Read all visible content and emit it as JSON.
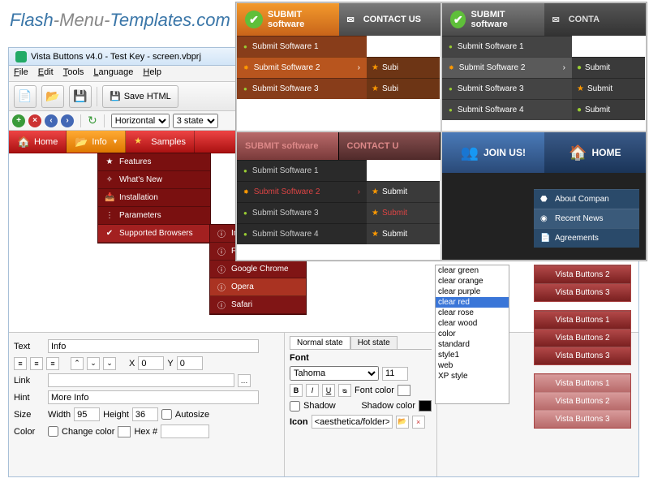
{
  "site_title_prefix": "Flash",
  "site_title_mid": "-Menu-",
  "site_title_suffix": "Templates.com",
  "window": {
    "title": "Vista Buttons v4.0 - Test Key - screen.vbprj"
  },
  "menubar": {
    "file": "File",
    "edit": "Edit",
    "tools": "Tools",
    "language": "Language",
    "help": "Help"
  },
  "toolbar": {
    "savehtml": "Save HTML"
  },
  "smallbar": {
    "orient_sel": "Horizontal",
    "state_sel": "3 state"
  },
  "rednav": {
    "home": "Home",
    "info": "Info",
    "samples": "Samples"
  },
  "submenu": {
    "items": [
      {
        "icon": "★",
        "label": "Features"
      },
      {
        "icon": "✧",
        "label": "What's New"
      },
      {
        "icon": "📥",
        "label": "Installation"
      },
      {
        "icon": "⋮",
        "label": "Parameters"
      },
      {
        "icon": "✔",
        "label": "Supported Browsers"
      }
    ]
  },
  "submenu2": {
    "items": [
      {
        "icon": "ⓘ",
        "label": "Internet Explorer"
      },
      {
        "icon": "ⓘ",
        "label": "Firefox"
      },
      {
        "icon": "ⓘ",
        "label": "Google Chrome"
      },
      {
        "icon": "ⓘ",
        "label": "Opera"
      },
      {
        "icon": "ⓘ",
        "label": "Safari"
      }
    ]
  },
  "props": {
    "text_label": "Text",
    "text_value": "Info",
    "x_label": "X",
    "x_value": "0",
    "y_label": "Y",
    "y_value": "0",
    "link_label": "Link",
    "link_value": "",
    "hint_label": "Hint",
    "hint_value": "More Info",
    "size_label": "Size",
    "width_label": "Width",
    "width_value": "95",
    "height_label": "Height",
    "height_value": "36",
    "autosize": "Autosize",
    "color_label": "Color",
    "changecolor": "Change color",
    "hex_label": "Hex #",
    "hex_value": "",
    "tab_normal": "Normal state",
    "tab_hot": "Hot state",
    "font_label": "Font",
    "font_value": "Tahoma",
    "font_size": "11",
    "fontcolor_label": "Font color",
    "shadow_label": "Shadow",
    "shadowcolor_label": "Shadow color",
    "icon_label": "Icon",
    "icon_value": "<aesthetica/folder>"
  },
  "themelist": {
    "items": [
      "clear green",
      "clear orange",
      "clear purple",
      "clear red",
      "clear rose",
      "clear wood",
      "color",
      "standard",
      "style1",
      "web",
      "XP style"
    ],
    "selected": "clear red"
  },
  "vbuttons": {
    "b1": "Vista Buttons 1",
    "b2": "Vista Buttons 2",
    "b3": "Vista Buttons 3"
  },
  "preview": {
    "submit_btn": "SUBMIT\nsoftware",
    "submit_label": "SUBMIT software",
    "contact": "CONTACT US",
    "contact_short": "CONTACT U",
    "conta": "CONTA",
    "sub1": "Submit Software 1",
    "sub2": "Submit Software 2",
    "sub3": "Submit Software 3",
    "sub4": "Submit Software 4",
    "subm": "Submit",
    "subi": "Subi",
    "join": "JOIN US!",
    "home": "HOME",
    "about": "About Compan",
    "recent": "Recent News",
    "agree": "Agreements"
  }
}
